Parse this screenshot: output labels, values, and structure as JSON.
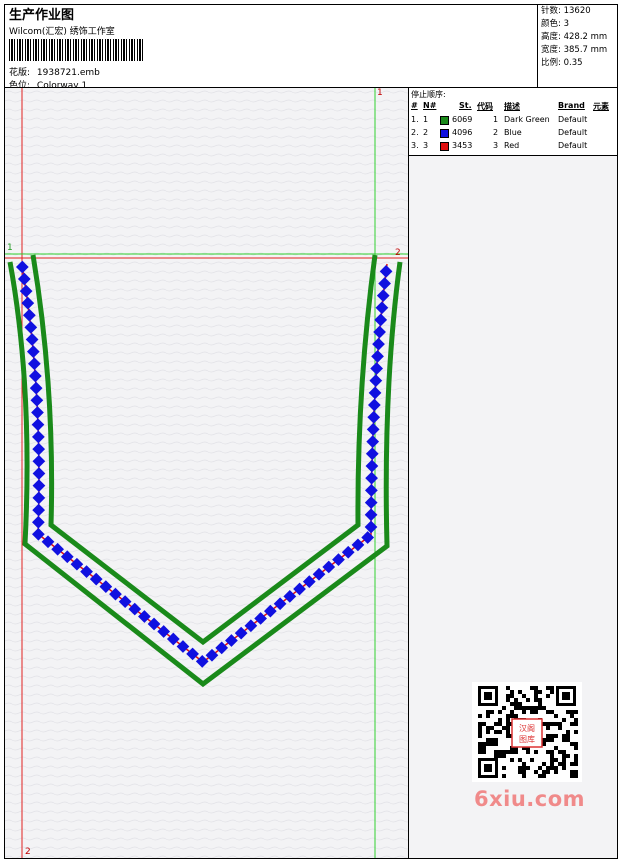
{
  "header": {
    "title": "生产作业图",
    "company": "Wilcom(汇宏) 绣饰工作室",
    "design_label": "花版:",
    "design_value": "1938721.emb",
    "colorway_label": "色位:",
    "colorway_value": "Colorway 1"
  },
  "stats": [
    {
      "label": "针数",
      "value": "13620"
    },
    {
      "label": "颜色",
      "value": "3"
    },
    {
      "label": "高度",
      "value": "428.2 mm"
    },
    {
      "label": "宽度",
      "value": "385.7 mm"
    },
    {
      "label": "比例",
      "value": "0.35"
    }
  ],
  "stop_sequence": {
    "title": "停止顺序:",
    "headers": {
      "num": "#",
      "n": "N#",
      "st": "St.",
      "code": "代码",
      "desc": "描述",
      "brand": "Brand",
      "element": "元素"
    },
    "rows": [
      {
        "num": "1.",
        "n": "1",
        "st": "6069",
        "code": "1",
        "desc": "Dark Green",
        "brand": "Default",
        "color": "#1a8a1a"
      },
      {
        "num": "2.",
        "n": "2",
        "st": "4096",
        "code": "2",
        "desc": "Blue",
        "brand": "Default",
        "color": "#1010e0"
      },
      {
        "num": "3.",
        "n": "3",
        "st": "3453",
        "code": "3",
        "desc": "Red",
        "brand": "Default",
        "color": "#e01010"
      }
    ]
  },
  "markers": {
    "v_top": "1",
    "v_bottom": "2",
    "h_left": "1",
    "h_right": "2"
  },
  "colors": {
    "guide_red": "#e02020",
    "guide_green": "#30d030",
    "outline": "#1a8a1a",
    "bead": "#1010e0",
    "bead_stitch": "#e01010"
  },
  "watermark": "6xiu.com",
  "qr_stamp": "汉阁图库"
}
